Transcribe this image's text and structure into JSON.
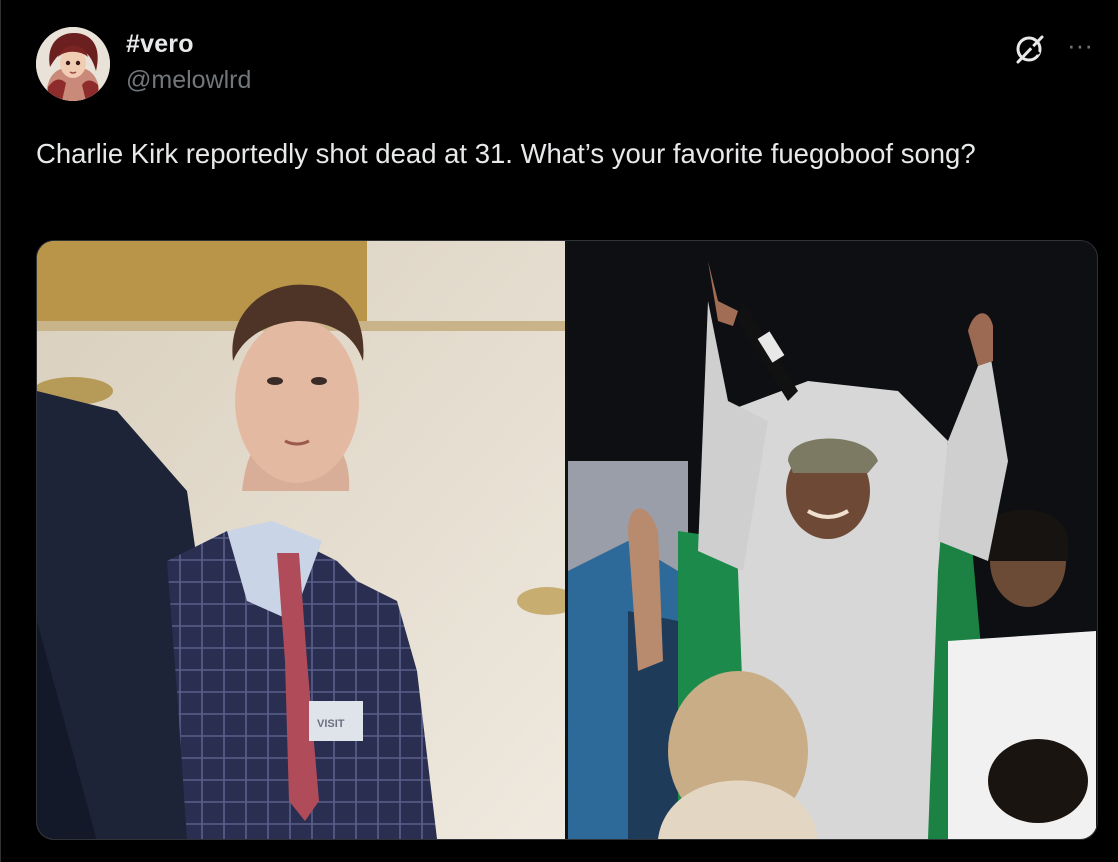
{
  "tweet": {
    "display_name": "#vero",
    "handle": "@melowlrd",
    "text": "Charlie Kirk reportedly shot dead at 31. What’s your favorite fuegoboof song?"
  },
  "media": {
    "left_photo": {
      "badge_text": "VISIT"
    }
  },
  "icons": {
    "grok": "grok-icon",
    "more": "more-icon"
  },
  "colors": {
    "background": "#000000",
    "primary_text": "#e7e9ea",
    "secondary_text": "#71767b",
    "border": "#2f3336"
  }
}
